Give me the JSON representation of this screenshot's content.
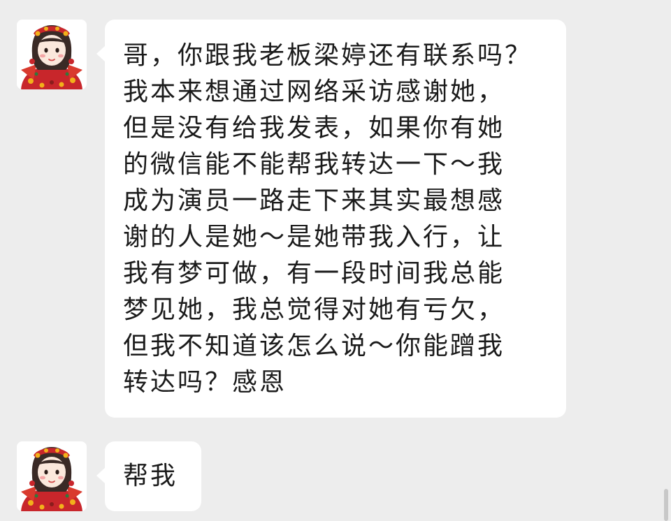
{
  "messages": [
    {
      "sender": "other",
      "lines": [
        "哥，你跟我老板梁婷还有联系吗？",
        "我本来想通过网络采访感谢她，",
        "但是没有给我发表，如果你有她",
        "的微信能不能帮我转达一下～我",
        "成为演员一路走下来其实最想感",
        "谢的人是她～是她带我入行，让",
        "我有梦可做，有一段时间我总能",
        "梦见她，我总觉得对她有亏欠，",
        "但我不知道该怎么说～你能蹭我",
        "转达吗？感恩"
      ]
    },
    {
      "sender": "other",
      "lines": [
        "帮我"
      ]
    }
  ],
  "avatar_icon": "cartoon-girl-red-outfit-avatar",
  "colors": {
    "background": "#ededed",
    "bubble": "#ffffff",
    "text": "#1b1b1b"
  }
}
